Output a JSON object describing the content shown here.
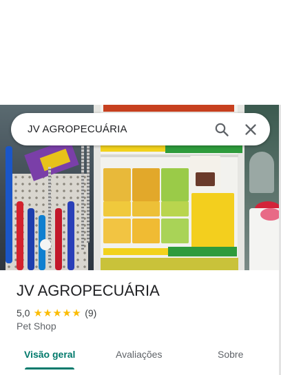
{
  "search": {
    "query": "JV AGROPECUÁRIA",
    "search_icon": "search-icon",
    "close_icon": "close-icon"
  },
  "place": {
    "name": "JV AGROPECUÁRIA",
    "rating": "5,0",
    "stars": "★★★★★",
    "review_count": "(9)",
    "category": "Pet Shop"
  },
  "tabs": [
    {
      "label": "Visão geral",
      "active": true
    },
    {
      "label": "Avaliações",
      "active": false
    },
    {
      "label": "Sobre",
      "active": false
    }
  ],
  "colors": {
    "accent": "#00796b",
    "star": "#fbbc04"
  }
}
